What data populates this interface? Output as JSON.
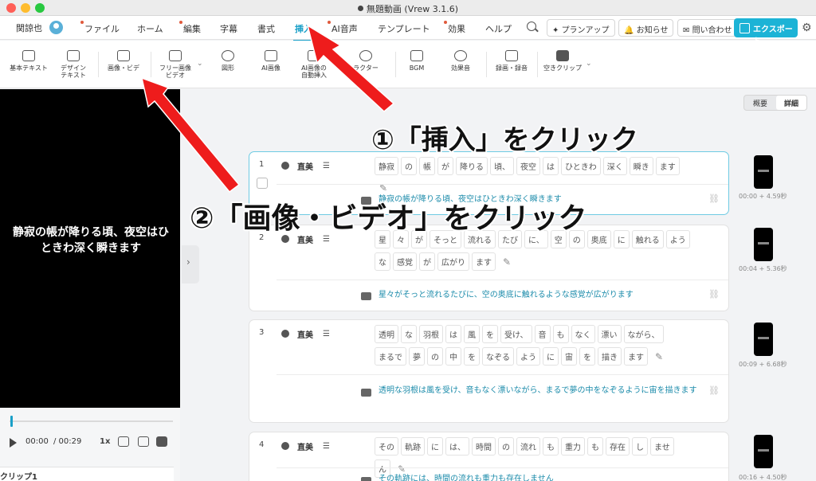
{
  "window": {
    "title": "無題動画 (Vrew 3.1.6)"
  },
  "menubar": {
    "user": "関諒也",
    "items": [
      {
        "label": "ファイル",
        "dot": true
      },
      {
        "label": "ホーム",
        "dot": false
      },
      {
        "label": "編集",
        "dot": true
      },
      {
        "label": "字幕",
        "dot": false
      },
      {
        "label": "書式",
        "dot": false
      },
      {
        "label": "挿入",
        "dot": false,
        "active": true
      },
      {
        "label": "AI音声",
        "dot": true
      },
      {
        "label": "テンプレート",
        "dot": false
      },
      {
        "label": "効果",
        "dot": true
      },
      {
        "label": "ヘルプ",
        "dot": false
      }
    ],
    "plan_label": "プランアップ",
    "notice_label": "お知らせ",
    "contact_label": "問い合わせ",
    "export_label": "エクスポート"
  },
  "toolbar": {
    "items": [
      {
        "label1": "基本テキスト",
        "label2": ""
      },
      {
        "label1": "デザイン",
        "label2": "テキスト"
      },
      {
        "label1": "画像・ビデ",
        "label2": ""
      },
      {
        "label1": "フリー画像",
        "label2": "ビデオ"
      },
      {
        "label1": "図形",
        "label2": ""
      },
      {
        "label1": "AI画像",
        "label2": ""
      },
      {
        "label1": "AI画像の",
        "label2": "自動挿入"
      },
      {
        "label1": "ラクター",
        "label2": ""
      },
      {
        "label1": "BGM",
        "label2": ""
      },
      {
        "label1": "効果音",
        "label2": ""
      },
      {
        "label1": "録画・録音",
        "label2": ""
      },
      {
        "label1": "空きクリップ",
        "label2": ""
      }
    ]
  },
  "preview": {
    "subtitle": "静寂の帳が降りる頃、夜空はひときわ深く瞬きます",
    "current_time": "00:00",
    "total_time": "/ 00:29",
    "speed": "1x",
    "progress": 0.01,
    "clip_header": "クリップ1"
  },
  "view_toggle": {
    "summary": "概要",
    "detail": "詳細"
  },
  "clips": [
    {
      "number": "1",
      "speaker": "直美",
      "words": [
        "静寂",
        "の",
        "帳",
        "が",
        "降りる",
        "頃、",
        "夜空",
        "は",
        "ひときわ",
        "深く",
        "瞬き",
        "ます"
      ],
      "subtitle": "静寂の帳が降りる頃、夜空はひときわ深く瞬きます",
      "timestamp": "00:00 + 4.59秒"
    },
    {
      "number": "2",
      "speaker": "直美",
      "words": [
        "星",
        "々",
        "が",
        "そっと",
        "流れる",
        "たび",
        "に、",
        "空",
        "の",
        "奥底",
        "に",
        "触れる",
        "よう",
        "な",
        "感覚",
        "が",
        "広がり",
        "ます"
      ],
      "subtitle": "星々がそっと流れるたびに、空の奥底に触れるような感覚が広がります",
      "timestamp": "00:04 + 5.36秒"
    },
    {
      "number": "3",
      "speaker": "直美",
      "words": [
        "透明",
        "な",
        "羽根",
        "は",
        "風",
        "を",
        "受け、",
        "音",
        "も",
        "なく",
        "漂い",
        "ながら、",
        "まるで",
        "夢",
        "の",
        "中",
        "を",
        "なぞる",
        "よう",
        "に",
        "宙",
        "を",
        "描き",
        "ます"
      ],
      "subtitle": "透明な羽根は風を受け、音もなく漂いながら、まるで夢の中をなぞるように宙を描きます",
      "timestamp": "00:09 + 6.68秒"
    },
    {
      "number": "4",
      "speaker": "直美",
      "words": [
        "その",
        "軌跡",
        "に",
        "は、",
        "時間",
        "の",
        "流れ",
        "も",
        "重力",
        "も",
        "存在",
        "し",
        "ませ",
        "ん"
      ],
      "subtitle": "その軌跡には、時間の流れも重力も存在しません",
      "timestamp": "00:16 + 4.50秒"
    }
  ],
  "annotations": {
    "step1": "①「挿入」をクリック",
    "step2": "②「画像・ビデオ」をクリック"
  },
  "colors": {
    "accent": "#1aa0c8",
    "export": "#1cb3d6",
    "arrow": "#ee1c1c",
    "subtitle_text": "#1d8cab"
  }
}
